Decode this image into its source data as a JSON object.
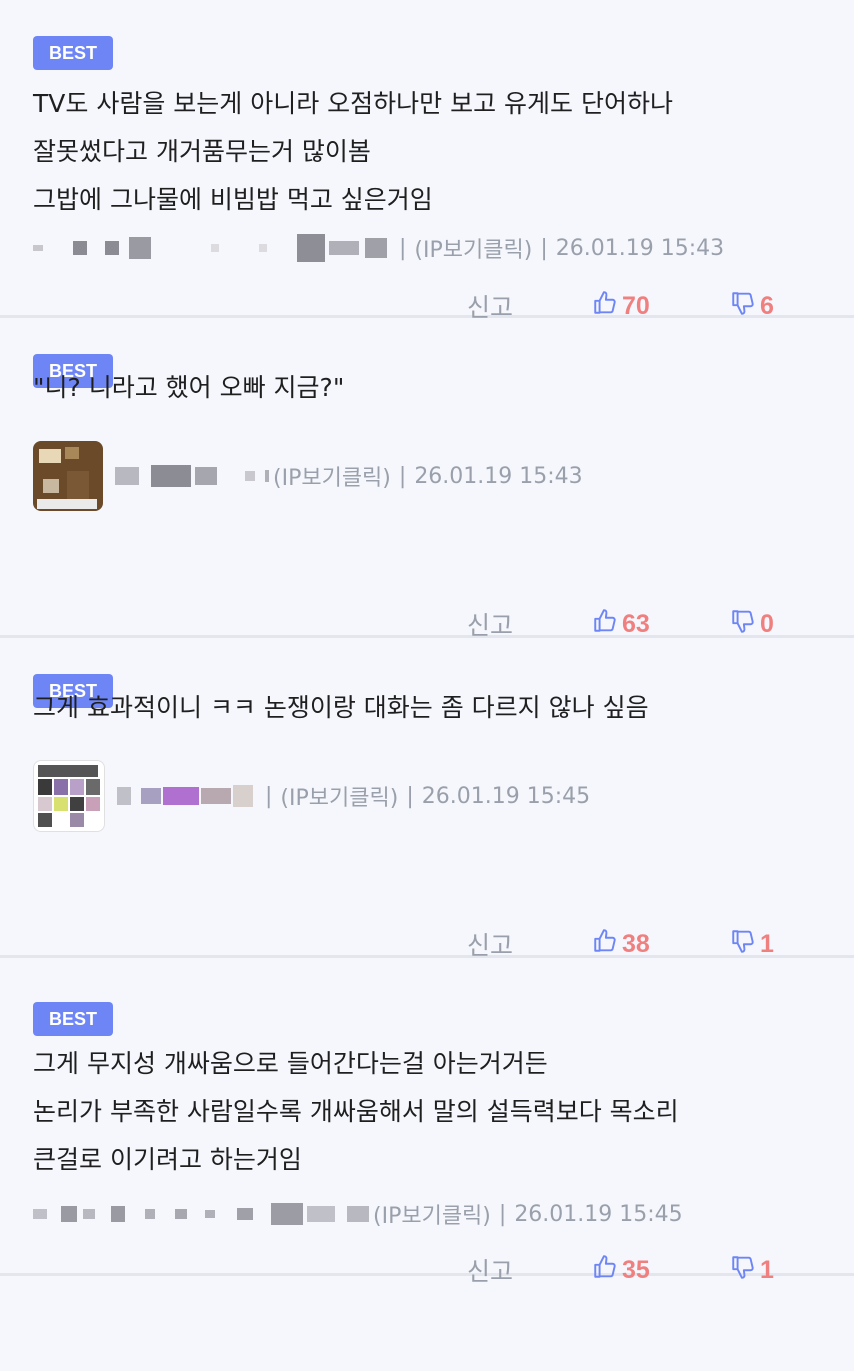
{
  "colors": {
    "background": "#f5f7fc",
    "badge": "#6e86f5",
    "meta": "#9aa0ab",
    "count": "#f08080",
    "thumb_icon": "#6e86f5"
  },
  "comments": [
    {
      "badge": "BEST",
      "lines": [
        "TV도 사람을 보는게 아니라 오점하나만 보고 유게도 단어하나",
        "잘못썼다고 개거품무는거 많이봄",
        "그밥에 그나물에 비빔밥 먹고 싶은거임"
      ],
      "ip": "(IP보기클릭)",
      "timestamp": "26.01.19 15:43",
      "report_label": "신고",
      "likes": "70",
      "dislikes": "6"
    },
    {
      "badge": "BEST",
      "lines": [
        "\"니? 니라고 했어 오빠 지금?\""
      ],
      "ip": "(IP보기클릭)",
      "timestamp": "26.01.19 15:43",
      "report_label": "신고",
      "likes": "63",
      "dislikes": "0"
    },
    {
      "badge": "BEST",
      "lines": [
        "그게 효과적이니 ㅋㅋ 논쟁이랑 대화는 좀 다르지 않나 싶음"
      ],
      "ip": "(IP보기클릭)",
      "timestamp": "26.01.19 15:45",
      "report_label": "신고",
      "likes": "38",
      "dislikes": "1"
    },
    {
      "badge": "BEST",
      "lines": [
        "그게 무지성 개싸움으로 들어간다는걸 아는거거든",
        "논리가 부족한 사람일수록 개싸움해서 말의 설득력보다 목소리",
        "큰걸로 이기려고 하는거임"
      ],
      "ip": "(IP보기클릭)",
      "timestamp": "26.01.19 15:45",
      "report_label": "신고",
      "likes": "35",
      "dislikes": "1"
    }
  ]
}
